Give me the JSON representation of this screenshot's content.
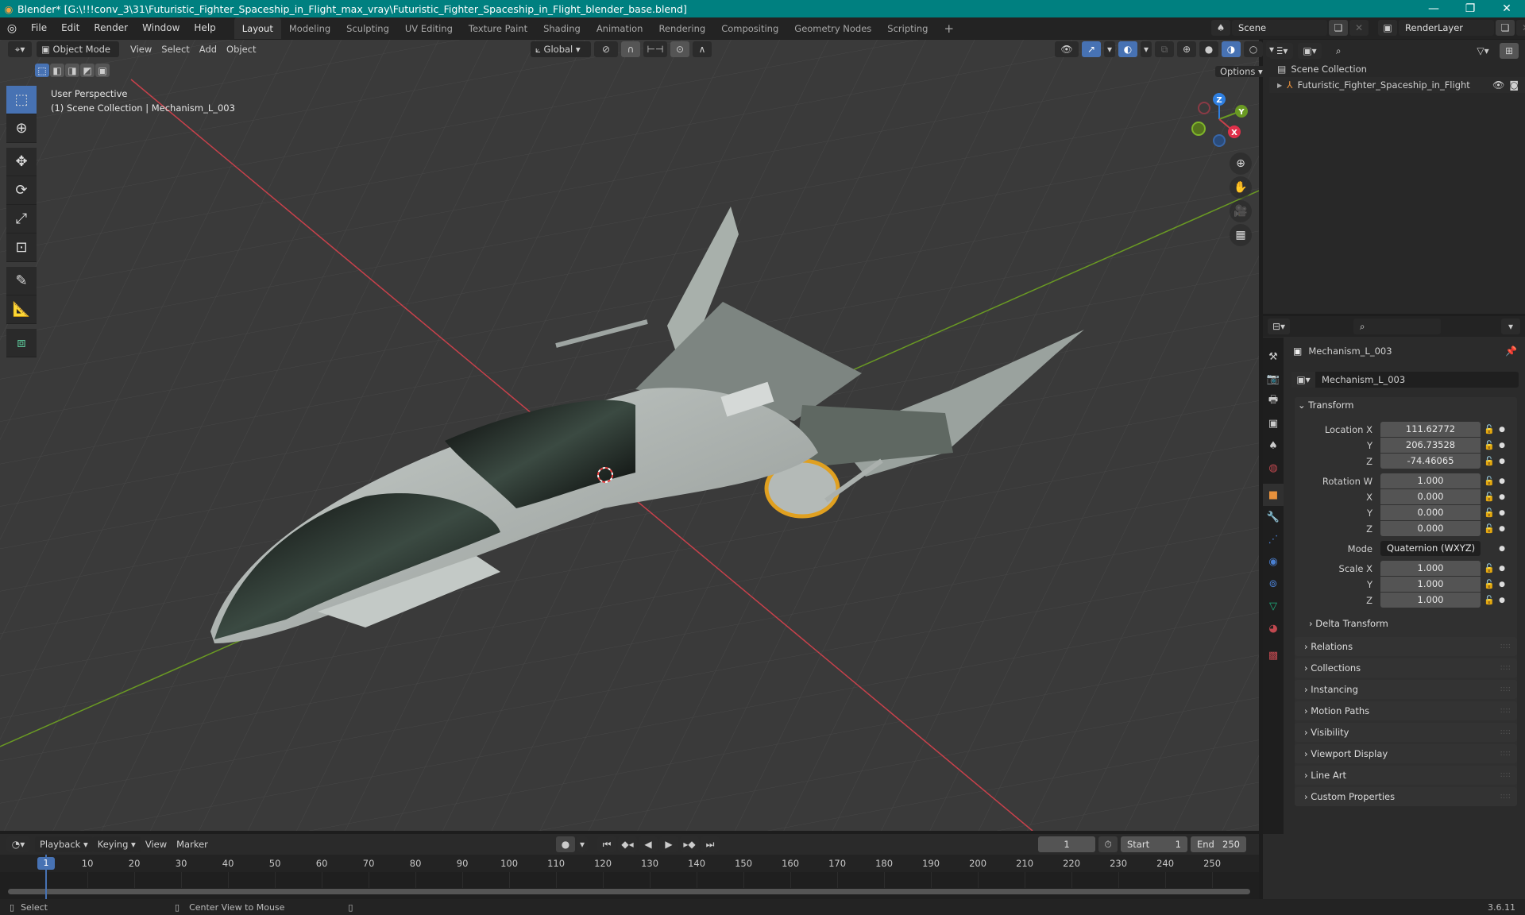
{
  "window": {
    "title": "Blender* [G:\\!!!conv_3\\31\\Futuristic_Fighter_Spaceship_in_Flight_max_vray\\Futuristic_Fighter_Spaceship_in_Flight_blender_base.blend]",
    "controls": {
      "minimize": "—",
      "maximize": "❐",
      "close": "✕"
    }
  },
  "menubar": {
    "items": [
      "File",
      "Edit",
      "Render",
      "Window",
      "Help"
    ],
    "workspaces": [
      "Layout",
      "Modeling",
      "Sculpting",
      "UV Editing",
      "Texture Paint",
      "Shading",
      "Animation",
      "Rendering",
      "Compositing",
      "Geometry Nodes",
      "Scripting"
    ],
    "active_workspace": "Layout",
    "add_tab": "+",
    "scene": "Scene",
    "view_layer": "RenderLayer"
  },
  "viewport_header": {
    "mode": "Object Mode",
    "menus": [
      "View",
      "Select",
      "Add",
      "Object"
    ],
    "orientation": "Global",
    "options": "Options"
  },
  "viewport": {
    "perspective": "User Perspective",
    "collection_info": "(1) Scene Collection | Mechanism_L_003",
    "axes": {
      "x": "X",
      "y": "Y",
      "z": "Z"
    }
  },
  "outliner": {
    "root": "Scene Collection",
    "items": [
      {
        "name": "Futuristic_Fighter_Spaceship_in_Flight"
      }
    ]
  },
  "properties": {
    "object_name": "Mechanism_L_003",
    "data_name": "Mechanism_L_003",
    "transform_label": "Transform",
    "location": {
      "label": "Location X",
      "x": "111.62772",
      "y": "206.73528",
      "z": "-74.46065"
    },
    "rotation": {
      "label": "Rotation W",
      "w": "1.000",
      "x": "0.000",
      "y": "0.000",
      "z": "0.000"
    },
    "mode_label": "Mode",
    "mode": "Quaternion (WXYZ)",
    "scale": {
      "label": "Scale X",
      "x": "1.000",
      "y": "1.000",
      "z": "1.000"
    },
    "axis_labels": {
      "y": "Y",
      "z": "Z",
      "x": "X"
    },
    "delta_transform": "Delta Transform",
    "panels": [
      "Relations",
      "Collections",
      "Instancing",
      "Motion Paths",
      "Visibility",
      "Viewport Display",
      "Line Art",
      "Custom Properties"
    ]
  },
  "timeline": {
    "menus": [
      "Playback",
      "Keying",
      "View",
      "Marker"
    ],
    "current_frame": "1",
    "start_label": "Start",
    "start": "1",
    "end_label": "End",
    "end": "250",
    "ticks": [
      "1",
      "10",
      "20",
      "30",
      "40",
      "50",
      "60",
      "70",
      "80",
      "90",
      "100",
      "110",
      "120",
      "130",
      "140",
      "150",
      "160",
      "170",
      "180",
      "190",
      "200",
      "210",
      "220",
      "230",
      "240",
      "250"
    ]
  },
  "statusbar": {
    "select": "Select",
    "center_view": "Center View to Mouse",
    "version": "3.6.11"
  },
  "colors": {
    "titlebar": "#008080",
    "accent_blue": "#4772b3",
    "x_axis": "#c8414b",
    "y_axis": "#6a9a23",
    "z_axis": "#2f7fe0",
    "object_orange": "#e8913c"
  }
}
